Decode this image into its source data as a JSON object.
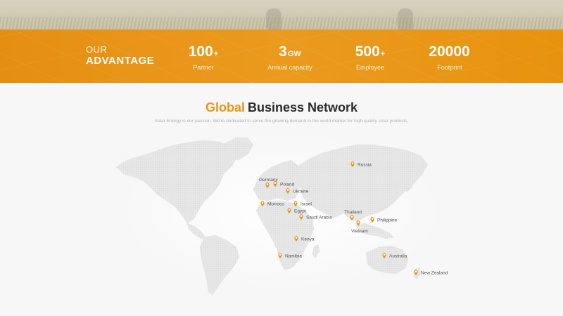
{
  "advantage": {
    "heading_line1": "OUR",
    "heading_line2": "ADVANTAGE",
    "stats": [
      {
        "value": "100",
        "unit": "+",
        "label": "Partner"
      },
      {
        "value": "3",
        "unit": "GW",
        "label": "Annual capacity"
      },
      {
        "value": "500",
        "unit": "+",
        "label": "Employee"
      },
      {
        "value": "20000",
        "unit": "",
        "label": "Footprint"
      }
    ]
  },
  "network": {
    "title_accent": "Global",
    "title_rest": "Business Network",
    "subtitle": "Solar Energy is our passion. We're dedicated to serve the growing demand in the world market for high quality solar products."
  },
  "locations": [
    {
      "name": "Russia",
      "icon": "map-pin-icon"
    },
    {
      "name": "Germany",
      "icon": "map-pin-icon"
    },
    {
      "name": "Poland",
      "icon": "map-pin-icon"
    },
    {
      "name": "Ukraine",
      "icon": "map-pin-icon"
    },
    {
      "name": "Morroco",
      "icon": "map-pin-icon"
    },
    {
      "name": "Israel",
      "icon": "map-pin-icon"
    },
    {
      "name": "Egypt",
      "icon": "map-pin-icon"
    },
    {
      "name": "Saudi Arabia",
      "icon": "map-pin-icon"
    },
    {
      "name": "Thailand",
      "icon": "map-pin-icon"
    },
    {
      "name": "Vietnam",
      "icon": "map-pin-icon"
    },
    {
      "name": "Philippine",
      "icon": "map-pin-icon"
    },
    {
      "name": "Kenya",
      "icon": "map-pin-icon"
    },
    {
      "name": "Namibia",
      "icon": "map-pin-icon"
    },
    {
      "name": "Australia",
      "icon": "map-pin-icon"
    },
    {
      "name": "New Zealand",
      "icon": "map-pin-icon"
    }
  ],
  "colors": {
    "accent": "#ea9415",
    "band": "#e8941a",
    "land": "#e6e6e6",
    "background": "#f7f7f7"
  }
}
